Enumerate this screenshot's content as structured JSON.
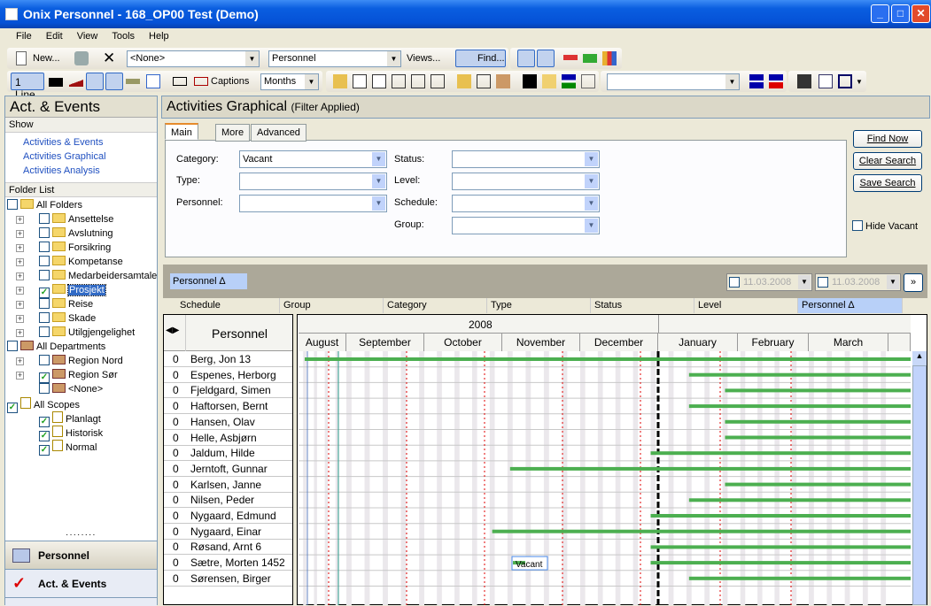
{
  "window": {
    "title": "Onix Personnel - 168_OP00 Test (Demo)"
  },
  "menu": [
    "File",
    "Edit",
    "View",
    "Tools",
    "Help"
  ],
  "toolbar": {
    "new_label": "New...",
    "view_filter": "<None>",
    "module": "Personnel",
    "views_label": "Views...",
    "find_label": "Find...",
    "lines_label": "1 Line",
    "captions_label": "Captions",
    "scale": "Months",
    "extra_combo": ""
  },
  "sidebar": {
    "title": "Act. & Events",
    "show_label": "Show",
    "show_links": [
      "Activities & Events",
      "Activities Graphical",
      "Activities Analysis"
    ],
    "folder_list_label": "Folder List",
    "folders": [
      {
        "label": "All Folders",
        "level": 0,
        "checked": false,
        "icon": "folder-icon"
      },
      {
        "label": "Ansettelse",
        "level": 1,
        "checked": false,
        "icon": "folder-icon"
      },
      {
        "label": "Avslutning",
        "level": 1,
        "checked": false,
        "icon": "folder-icon"
      },
      {
        "label": "Forsikring",
        "level": 1,
        "checked": false,
        "icon": "folder-icon"
      },
      {
        "label": "Kompetanse",
        "level": 1,
        "checked": false,
        "icon": "folder-icon"
      },
      {
        "label": "Medarbeidersamtale",
        "level": 1,
        "checked": false,
        "icon": "folder-icon"
      },
      {
        "label": "Prosjekt",
        "level": 1,
        "checked": true,
        "icon": "folder-icon",
        "selected": true
      },
      {
        "label": "Reise",
        "level": 1,
        "checked": false,
        "icon": "folder-icon"
      },
      {
        "label": "Skade",
        "level": 1,
        "checked": false,
        "icon": "folder-icon"
      },
      {
        "label": "Utilgjengelighet",
        "level": 1,
        "checked": false,
        "icon": "folder-icon"
      },
      {
        "label": "All Departments",
        "level": 0,
        "checked": false,
        "icon": "house-icon"
      },
      {
        "label": "Region Nord",
        "level": 1,
        "checked": false,
        "icon": "house-icon"
      },
      {
        "label": "Region Sør",
        "level": 1,
        "checked": true,
        "icon": "house-icon"
      },
      {
        "label": "<None>",
        "level": 1,
        "checked": false,
        "icon": "house-icon",
        "noexpand": true
      },
      {
        "label": "All Scopes",
        "level": 0,
        "checked": true,
        "icon": "scope-icon"
      },
      {
        "label": "Planlagt",
        "level": 1,
        "checked": true,
        "icon": "scope-icon",
        "noexpand": true
      },
      {
        "label": "Historisk",
        "level": 1,
        "checked": true,
        "icon": "scope-icon",
        "noexpand": true
      },
      {
        "label": "Normal",
        "level": 1,
        "checked": true,
        "icon": "scope-icon",
        "noexpand": true
      }
    ],
    "nav": [
      "Personnel",
      "Act. & Events"
    ]
  },
  "main": {
    "title": "Activities Graphical",
    "subtitle": "(Filter Applied)",
    "tabs": [
      "Main",
      "More",
      "Advanced"
    ],
    "fields": {
      "category_label": "Category:",
      "category": "Vacant",
      "type_label": "Type:",
      "type": "",
      "personnel_label": "Personnel:",
      "personnel": "",
      "status_label": "Status:",
      "status": "",
      "level_label": "Level:",
      "level": "",
      "schedule_label": "Schedule:",
      "schedule": "",
      "group_label": "Group:",
      "group": ""
    },
    "buttons": {
      "find_now": "Find Now",
      "clear_search": "Clear Search",
      "save_search": "Save Search"
    },
    "hide_vacant_label": "Hide Vacant",
    "hide_vacant": false,
    "group_by": "Personnel ∆",
    "date_from": "11.03.2008",
    "date_to": "11.03.2008",
    "more": "»",
    "columns": [
      "Schedule",
      "Group",
      "Category",
      "Type",
      "Status",
      "Level",
      "Personnel ∆"
    ],
    "gantt": {
      "personnel_header": "Personnel",
      "year": "2008",
      "months": [
        "August",
        "September",
        "October",
        "November",
        "December",
        "January",
        "February",
        "March"
      ],
      "rows": [
        {
          "count": "0",
          "name": "Berg, Jon 13",
          "start": "2007-08-05"
        },
        {
          "count": "0",
          "name": "Espenes, Herborg",
          "start": "2008-01-13"
        },
        {
          "count": "0",
          "name": "Fjeldgard, Simen",
          "start": "2008-01-27"
        },
        {
          "count": "0",
          "name": "Haftorsen, Bernt",
          "start": "2008-01-13"
        },
        {
          "count": "0",
          "name": "Hansen, Olav",
          "start": "2008-01-27"
        },
        {
          "count": "0",
          "name": "Helle, Asbjørn",
          "start": "2008-01-27"
        },
        {
          "count": "0",
          "name": "Jaldum, Hilde",
          "start": "2007-12-29"
        },
        {
          "count": "0",
          "name": "Jerntoft, Gunnar",
          "start": "2007-11-04"
        },
        {
          "count": "0",
          "name": "Karlsen, Janne",
          "start": "2008-01-27"
        },
        {
          "count": "0",
          "name": "Nilsen, Peder",
          "start": "2008-01-13"
        },
        {
          "count": "0",
          "name": "Nygaard, Edmund",
          "start": "2007-12-29"
        },
        {
          "count": "0",
          "name": "Nygaard, Einar",
          "start": "2007-10-28"
        },
        {
          "count": "0",
          "name": "Røsand, Arnt 6",
          "start": "2007-12-29"
        },
        {
          "count": "0",
          "name": "Sætre, Morten 1452",
          "start": "2007-12-29",
          "label": "Vacant"
        },
        {
          "count": "0",
          "name": "Sørensen, Birger",
          "start": "2008-01-13"
        }
      ]
    }
  },
  "colors": {
    "bar": "#4caf50",
    "accent": "#316ac5",
    "today": "#000000",
    "month_line": "#e00000"
  }
}
